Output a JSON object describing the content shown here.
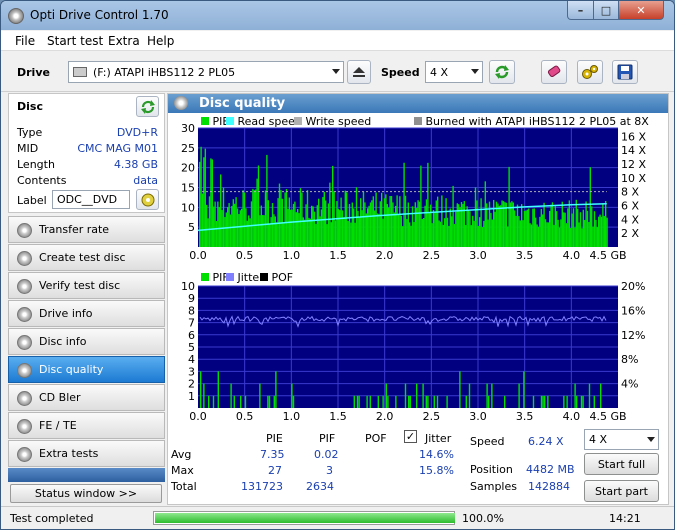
{
  "window": {
    "title": "Opti Drive Control 1.70"
  },
  "menu": [
    "File",
    "Start test",
    "Extra",
    "Help"
  ],
  "drivebar": {
    "drive_label": "Drive",
    "drive_value": "(F:)   ATAPI iHBS112   2 PL05",
    "speed_label": "Speed",
    "speed_value": "4 X"
  },
  "disc": {
    "header": "Disc",
    "rows": [
      {
        "label": "Type",
        "value": "DVD+R"
      },
      {
        "label": "MID",
        "value": "CMC MAG M01"
      },
      {
        "label": "Length",
        "value": "4.38 GB"
      },
      {
        "label": "Contents",
        "value": "data"
      }
    ],
    "label_label": "Label",
    "label_value": "ODC__DVD"
  },
  "nav": [
    "Transfer rate",
    "Create test disc",
    "Verify test disc",
    "Drive info",
    "Disc info",
    "Disc quality",
    "CD Bler",
    "FE / TE",
    "Extra tests"
  ],
  "nav_active": "Disc quality",
  "status_window_btn": "Status window >>",
  "panel": {
    "title": "Disc quality"
  },
  "chart_data": [
    {
      "type": "bar",
      "legend": [
        "PIE",
        "Read speed",
        "Write speed"
      ],
      "burned_note": "Burned with ATAPI iHBS112   2 PL05 at 8X",
      "x_ticks": [
        "0.0",
        "0.5",
        "1.0",
        "1.5",
        "2.0",
        "2.5",
        "3.0",
        "3.5",
        "4.0",
        "4.5 GB"
      ],
      "y_ticks_left": [
        "30",
        "25",
        "20",
        "15",
        "10",
        "5"
      ],
      "y_ticks_right": [
        "16 X",
        "14 X",
        "12 X",
        "10 X",
        "8 X",
        "6 X",
        "4 X",
        "2 X"
      ],
      "xlim": [
        0,
        4.5
      ],
      "ylim": [
        0,
        30
      ],
      "pie_avg": 7.35,
      "pie_max": 27,
      "read_speed": {
        "x": [
          0.0,
          0.5,
          1.0,
          1.5,
          2.0,
          2.5,
          3.0,
          3.5,
          4.0,
          4.38
        ],
        "y": [
          2.4,
          3.0,
          3.6,
          4.1,
          4.6,
          5.0,
          5.4,
          5.8,
          6.1,
          6.24
        ]
      },
      "write_speed_x": 8,
      "colors": {
        "pie": "#00e000",
        "read": "#40ffff",
        "write": "#b0b0b0",
        "bg": "#000080"
      }
    },
    {
      "type": "bar",
      "legend": [
        "PIF",
        "Jitter",
        "POF"
      ],
      "x_ticks": [
        "0.0",
        "0.5",
        "1.0",
        "1.5",
        "2.0",
        "2.5",
        "3.0",
        "3.5",
        "4.0",
        "4.5 GB"
      ],
      "y_ticks_left": [
        "10",
        "9",
        "8",
        "7",
        "6",
        "5",
        "4",
        "3",
        "2",
        "1"
      ],
      "y_ticks_right": [
        "20%",
        "16%",
        "12%",
        "8%",
        "4%"
      ],
      "xlim": [
        0,
        4.5
      ],
      "ylim": [
        0,
        10
      ],
      "jitter_avg": 14.6,
      "colors": {
        "pif": "#00e000",
        "jitter": "#8080ff",
        "pof": "#000000",
        "bg": "#000080"
      }
    }
  ],
  "stats": {
    "headers": [
      "PIE",
      "PIF",
      "POF",
      "Jitter"
    ],
    "rows": [
      {
        "name": "Avg",
        "pie": "7.35",
        "pif": "0.02",
        "pof": "",
        "jitter": "14.6%"
      },
      {
        "name": "Max",
        "pie": "27",
        "pif": "3",
        "pof": "",
        "jitter": "15.8%"
      },
      {
        "name": "Total",
        "pie": "131723",
        "pif": "2634",
        "pof": "",
        "jitter": ""
      }
    ],
    "speed_label": "Speed",
    "speed_value": "6.24 X",
    "position_label": "Position",
    "position_value": "4482 MB",
    "samples_label": "Samples",
    "samples_value": "142884",
    "speed_select": "4 X",
    "start_full": "Start full",
    "start_part": "Start part"
  },
  "statusbar": {
    "text": "Test completed",
    "progress": 1.0,
    "progress_text": "100.0%",
    "time": "14:21"
  }
}
